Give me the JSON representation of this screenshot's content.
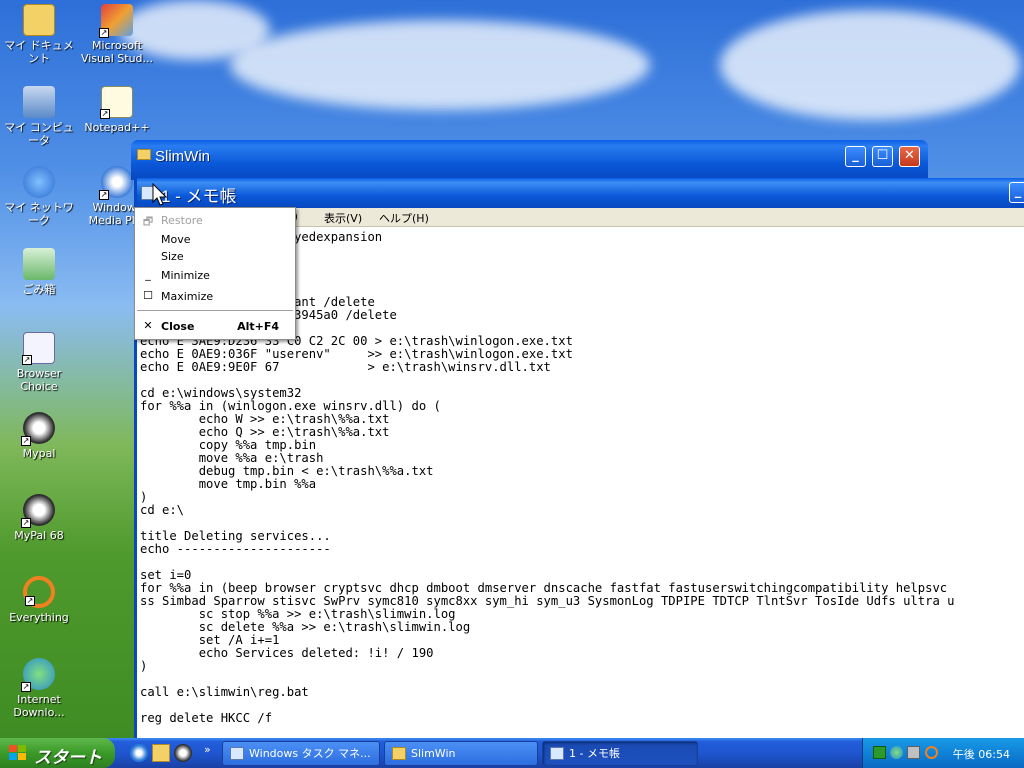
{
  "desktop": {
    "icons": [
      {
        "label": "マイ ドキュメント"
      },
      {
        "label": "Microsoft Visual Stud..."
      },
      {
        "label": "マイ コンピュータ"
      },
      {
        "label": "Notepad++"
      },
      {
        "label": "マイ ネットワーク"
      },
      {
        "label": "Windows Media Pl..."
      },
      {
        "label": "ごみ箱"
      },
      {
        "label": "Browser Choice"
      },
      {
        "label": "Mypal"
      },
      {
        "label": "MyPal 68"
      },
      {
        "label": "Everything"
      },
      {
        "label": "Internet Downlo..."
      }
    ]
  },
  "slimwin_window": {
    "title": "SlimWin"
  },
  "notepad": {
    "title": "1 - メモ帳",
    "menu": [
      "表示(V)",
      "ヘルプ(H)"
    ],
    "partial_menu": "O)",
    "lines": [
      "                     yedexpansion",
      "",
      "",
      "",
      "",
      "                     ant /delete",
      "                     3945a0 /delete",
      "",
      "echo E 3AE9:D236 33 C0 C2 2C 00 > e:\\trash\\winlogon.exe.txt",
      "echo E 0AE9:036F \"userenv\"     >> e:\\trash\\winlogon.exe.txt",
      "echo E 0AE9:9E0F 67            > e:\\trash\\winsrv.dll.txt",
      "",
      "cd e:\\windows\\system32",
      "for %%a in (winlogon.exe winsrv.dll) do (",
      "        echo W >> e:\\trash\\%%a.txt",
      "        echo Q >> e:\\trash\\%%a.txt",
      "        copy %%a tmp.bin",
      "        move %%a e:\\trash",
      "        debug tmp.bin < e:\\trash\\%%a.txt",
      "        move tmp.bin %%a",
      ")",
      "cd e:\\",
      "",
      "title Deleting services...",
      "echo ---------------------",
      "",
      "set i=0",
      "for %%a in (beep browser cryptsvc dhcp dmboot dmserver dnscache fastfat fastuserswitchingcompatibility helpsvc",
      "ss Simbad Sparrow stisvc SwPrv symc810 symc8xx sym_hi sym_u3 SysmonLog TDPIPE TDTCP TlntSvr TosIde Udfs ultra u",
      "        sc stop %%a >> e:\\trash\\slimwin.log",
      "        sc delete %%a >> e:\\trash\\slimwin.log",
      "        set /A i+=1",
      "        echo Services deleted: !i! / 190",
      ")",
      "",
      "call e:\\slimwin\\reg.bat",
      "",
      "reg delete HKCC /f"
    ]
  },
  "context_menu": {
    "items": [
      {
        "label": "Restore",
        "glyph": "🗗",
        "disabled": true
      },
      {
        "label": "Move",
        "glyph": "",
        "disabled": false
      },
      {
        "label": "Size",
        "glyph": "",
        "disabled": false
      },
      {
        "label": "Minimize",
        "glyph": "_",
        "disabled": false
      },
      {
        "label": "Maximize",
        "glyph": "☐",
        "disabled": false
      },
      {
        "label": "Close",
        "glyph": "✕",
        "accel": "Alt+F4",
        "disabled": false
      }
    ]
  },
  "taskbar": {
    "start_label": "スタート",
    "overflow": "»",
    "tasks": [
      {
        "label": "Windows タスク マネ..."
      },
      {
        "label": "SlimWin"
      },
      {
        "label": "1 - メモ帳"
      }
    ],
    "clock": "午後 06:54"
  }
}
